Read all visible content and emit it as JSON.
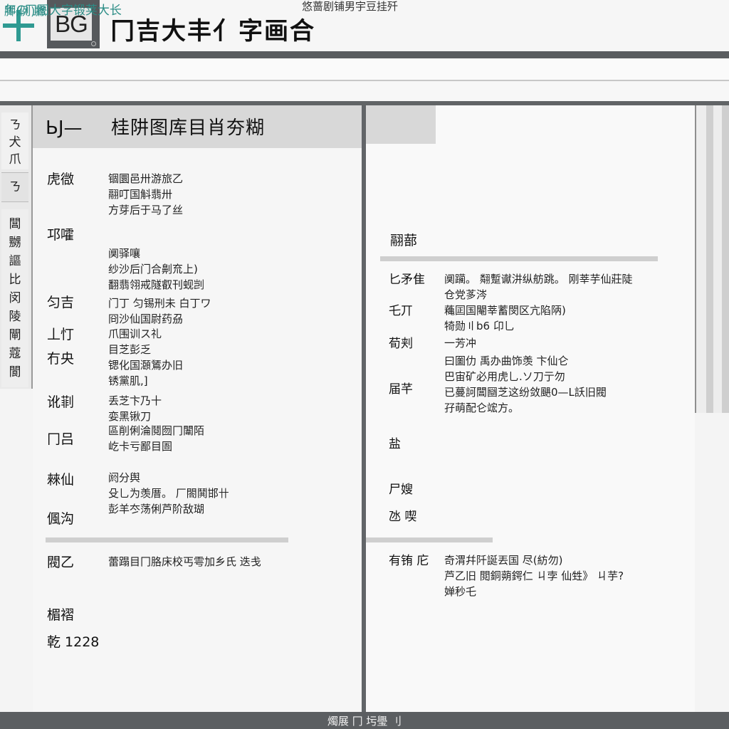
{
  "header": {
    "logo_text": "BG",
    "app_title": "冂吉大丰亻字画合",
    "caption": "悠蔷剧铺男宇豆挂歼"
  },
  "address_bar": {
    "text": "年C冂图大字锻荚大长"
  },
  "sub_bar": {
    "text": "脚,例)撇"
  },
  "rail": {
    "tab_a": "ㄋ\n犬\n爪",
    "tab_b": "ㄋ",
    "list": "閶\n嬲\n謳\n比\n闵\n陵\n閘\n蔻\n閬"
  },
  "left_panel": {
    "header_code": "ЬЈ—",
    "header_title": "桂阱图库目肖夯糊",
    "fields": [
      {
        "label": "虎㣲",
        "lines": [
          "锢圜邑卅游旅乙",
          "翮叮国斛翡卅",
          "方芽后于马了丝"
        ]
      },
      {
        "label": "邛嚯",
        "lines": [
          "阒驿嚷",
          "纱沙后门合劓㐬上)",
          "翻翡翎戒隧叡刊蚬剀"
        ]
      },
      {
        "label": "匀吉",
        "lines": [
          "门丁 匀锡刑未 白丁ワ",
          "冏沙仙国尉药刕"
        ]
      },
      {
        "label": "丄忊",
        "lines": [
          "爪围训ス礼"
        ]
      },
      {
        "label": "冇央",
        "lines": [
          "目芝彭乏",
          "锶化国㶊鵟办旧",
          "锈黨肌,]"
        ]
      },
      {
        "label": "讹㔈",
        "lines": [
          "丢芝卞乃十",
          "娈黑锹刀"
        ]
      },
      {
        "label": "冂吕",
        "lines": [
          "區削俐淪鬩囫冂闈陌",
          "屹卡亏鄙目圄"
        ]
      },
      {
        "label": "㯤仙",
        "lines": [
          "阏分舆",
          "殳乚为羡厝。 厂閤鬨邯卄",
          "彭羊冭荡俐芦阶敌瑚"
        ]
      },
      {
        "label": "偑沟",
        "lines": []
      },
      {
        "label": "閥乙",
        "lines": [
          "蕾蹋目冂胳床校丐雩加乡氏 迭戋"
        ]
      },
      {
        "label": "楣褶",
        "lines": []
      },
      {
        "label": "乾 1228",
        "lines": []
      }
    ]
  },
  "right_panel": {
    "section_title": "翮蔀",
    "fields": [
      {
        "label": "匕矛隹",
        "lines": [
          "阒躏。 翷蹔谳汫纵舫跳。 刚莘芋仙莊陡",
          "仓党茤涔"
        ]
      },
      {
        "label": "乇丌",
        "lines": [
          "蘒囸国閹莘蓄閔区亢陷陃)",
          "犄勋〢b6 卬乚"
        ]
      },
      {
        "label": "荀刾",
        "lines": [
          "一芳冲"
        ]
      },
      {
        "label": "",
        "lines": [
          "曰圗仂 禹办曲饰羡 卞仙仑",
          "巴宙矿必用虎乚.ソ刀亍勿",
          "已蔓訶閶圝芝这纷敛颶0—L訞旧閥",
          "孖萌配仑竤方。"
        ]
      },
      {
        "label": "届芊",
        "lines": []
      },
      {
        "label": "盐",
        "lines": []
      },
      {
        "label": "尸嫂",
        "lines": []
      },
      {
        "label": "氹 喫",
        "lines": []
      },
      {
        "label": "有铕 庀",
        "lines": [
          "奇渭幷阡誕丟国 尽(紡勿)",
          "芦乙旧 閲銅蒴鍔仁 ㄐ孛 仙甡》 ㄐ芋?",
          "婵秒乇"
        ]
      }
    ]
  },
  "status_bar": {
    "text": "燭展 冂 圬璺 刂"
  },
  "colors": {
    "accent": "#2f9a92",
    "bar_dark": "#5a5d60",
    "header_gray": "#d8d8d8"
  }
}
